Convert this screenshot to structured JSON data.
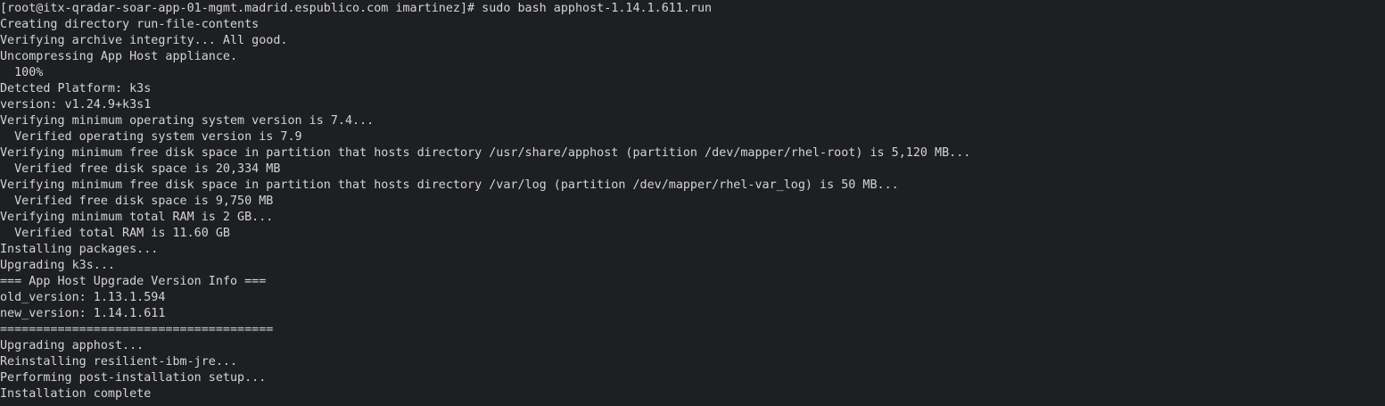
{
  "terminal": {
    "lines": [
      "[root@itx-qradar-soar-app-01-mgmt.madrid.espublico.com imartinez]# sudo bash apphost-1.14.1.611.run",
      "Creating directory run-file-contents",
      "Verifying archive integrity... All good.",
      "Uncompressing App Host appliance.",
      "  100%",
      "Detcted Platform: k3s",
      "version: v1.24.9+k3s1",
      "Verifying minimum operating system version is 7.4...",
      "  Verified operating system version is 7.9",
      "Verifying minimum free disk space in partition that hosts directory /usr/share/apphost (partition /dev/mapper/rhel-root) is 5,120 MB...",
      "  Verified free disk space is 20,334 MB",
      "Verifying minimum free disk space in partition that hosts directory /var/log (partition /dev/mapper/rhel-var_log) is 50 MB...",
      "  Verified free disk space is 9,750 MB",
      "Verifying minimum total RAM is 2 GB...",
      "  Verified total RAM is 11.60 GB",
      "Installing packages...",
      "Upgrading k3s...",
      "=== App Host Upgrade Version Info ===",
      "old_version: 1.13.1.594",
      "new_version: 1.14.1.611",
      "======================================",
      "Upgrading apphost...",
      "Reinstalling resilient-ibm-jre...",
      "Performing post-installation setup...",
      "Installation complete"
    ]
  },
  "colors": {
    "background": "#1e1f22",
    "text": "#d4d4d4"
  }
}
